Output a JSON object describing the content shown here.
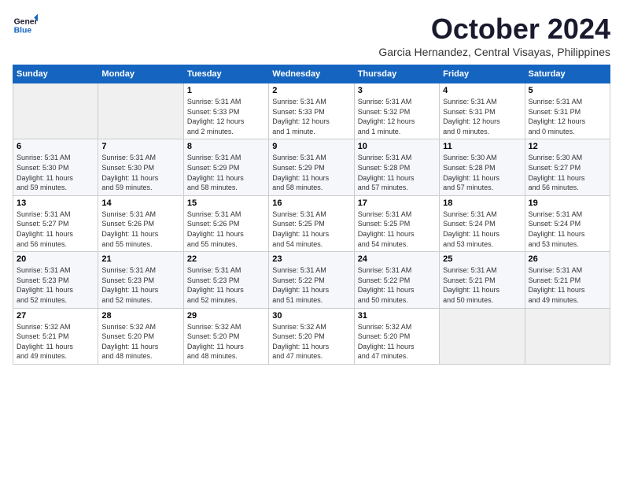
{
  "logo": {
    "line1": "General",
    "line2": "Blue"
  },
  "header": {
    "month_title": "October 2024",
    "subtitle": "Garcia Hernandez, Central Visayas, Philippines"
  },
  "weekdays": [
    "Sunday",
    "Monday",
    "Tuesday",
    "Wednesday",
    "Thursday",
    "Friday",
    "Saturday"
  ],
  "weeks": [
    [
      {
        "day": "",
        "info": ""
      },
      {
        "day": "",
        "info": ""
      },
      {
        "day": "1",
        "info": "Sunrise: 5:31 AM\nSunset: 5:33 PM\nDaylight: 12 hours\nand 2 minutes."
      },
      {
        "day": "2",
        "info": "Sunrise: 5:31 AM\nSunset: 5:33 PM\nDaylight: 12 hours\nand 1 minute."
      },
      {
        "day": "3",
        "info": "Sunrise: 5:31 AM\nSunset: 5:32 PM\nDaylight: 12 hours\nand 1 minute."
      },
      {
        "day": "4",
        "info": "Sunrise: 5:31 AM\nSunset: 5:31 PM\nDaylight: 12 hours\nand 0 minutes."
      },
      {
        "day": "5",
        "info": "Sunrise: 5:31 AM\nSunset: 5:31 PM\nDaylight: 12 hours\nand 0 minutes."
      }
    ],
    [
      {
        "day": "6",
        "info": "Sunrise: 5:31 AM\nSunset: 5:30 PM\nDaylight: 11 hours\nand 59 minutes."
      },
      {
        "day": "7",
        "info": "Sunrise: 5:31 AM\nSunset: 5:30 PM\nDaylight: 11 hours\nand 59 minutes."
      },
      {
        "day": "8",
        "info": "Sunrise: 5:31 AM\nSunset: 5:29 PM\nDaylight: 11 hours\nand 58 minutes."
      },
      {
        "day": "9",
        "info": "Sunrise: 5:31 AM\nSunset: 5:29 PM\nDaylight: 11 hours\nand 58 minutes."
      },
      {
        "day": "10",
        "info": "Sunrise: 5:31 AM\nSunset: 5:28 PM\nDaylight: 11 hours\nand 57 minutes."
      },
      {
        "day": "11",
        "info": "Sunrise: 5:30 AM\nSunset: 5:28 PM\nDaylight: 11 hours\nand 57 minutes."
      },
      {
        "day": "12",
        "info": "Sunrise: 5:30 AM\nSunset: 5:27 PM\nDaylight: 11 hours\nand 56 minutes."
      }
    ],
    [
      {
        "day": "13",
        "info": "Sunrise: 5:31 AM\nSunset: 5:27 PM\nDaylight: 11 hours\nand 56 minutes."
      },
      {
        "day": "14",
        "info": "Sunrise: 5:31 AM\nSunset: 5:26 PM\nDaylight: 11 hours\nand 55 minutes."
      },
      {
        "day": "15",
        "info": "Sunrise: 5:31 AM\nSunset: 5:26 PM\nDaylight: 11 hours\nand 55 minutes."
      },
      {
        "day": "16",
        "info": "Sunrise: 5:31 AM\nSunset: 5:25 PM\nDaylight: 11 hours\nand 54 minutes."
      },
      {
        "day": "17",
        "info": "Sunrise: 5:31 AM\nSunset: 5:25 PM\nDaylight: 11 hours\nand 54 minutes."
      },
      {
        "day": "18",
        "info": "Sunrise: 5:31 AM\nSunset: 5:24 PM\nDaylight: 11 hours\nand 53 minutes."
      },
      {
        "day": "19",
        "info": "Sunrise: 5:31 AM\nSunset: 5:24 PM\nDaylight: 11 hours\nand 53 minutes."
      }
    ],
    [
      {
        "day": "20",
        "info": "Sunrise: 5:31 AM\nSunset: 5:23 PM\nDaylight: 11 hours\nand 52 minutes."
      },
      {
        "day": "21",
        "info": "Sunrise: 5:31 AM\nSunset: 5:23 PM\nDaylight: 11 hours\nand 52 minutes."
      },
      {
        "day": "22",
        "info": "Sunrise: 5:31 AM\nSunset: 5:23 PM\nDaylight: 11 hours\nand 52 minutes."
      },
      {
        "day": "23",
        "info": "Sunrise: 5:31 AM\nSunset: 5:22 PM\nDaylight: 11 hours\nand 51 minutes."
      },
      {
        "day": "24",
        "info": "Sunrise: 5:31 AM\nSunset: 5:22 PM\nDaylight: 11 hours\nand 50 minutes."
      },
      {
        "day": "25",
        "info": "Sunrise: 5:31 AM\nSunset: 5:21 PM\nDaylight: 11 hours\nand 50 minutes."
      },
      {
        "day": "26",
        "info": "Sunrise: 5:31 AM\nSunset: 5:21 PM\nDaylight: 11 hours\nand 49 minutes."
      }
    ],
    [
      {
        "day": "27",
        "info": "Sunrise: 5:32 AM\nSunset: 5:21 PM\nDaylight: 11 hours\nand 49 minutes."
      },
      {
        "day": "28",
        "info": "Sunrise: 5:32 AM\nSunset: 5:20 PM\nDaylight: 11 hours\nand 48 minutes."
      },
      {
        "day": "29",
        "info": "Sunrise: 5:32 AM\nSunset: 5:20 PM\nDaylight: 11 hours\nand 48 minutes."
      },
      {
        "day": "30",
        "info": "Sunrise: 5:32 AM\nSunset: 5:20 PM\nDaylight: 11 hours\nand 47 minutes."
      },
      {
        "day": "31",
        "info": "Sunrise: 5:32 AM\nSunset: 5:20 PM\nDaylight: 11 hours\nand 47 minutes."
      },
      {
        "day": "",
        "info": ""
      },
      {
        "day": "",
        "info": ""
      }
    ]
  ]
}
